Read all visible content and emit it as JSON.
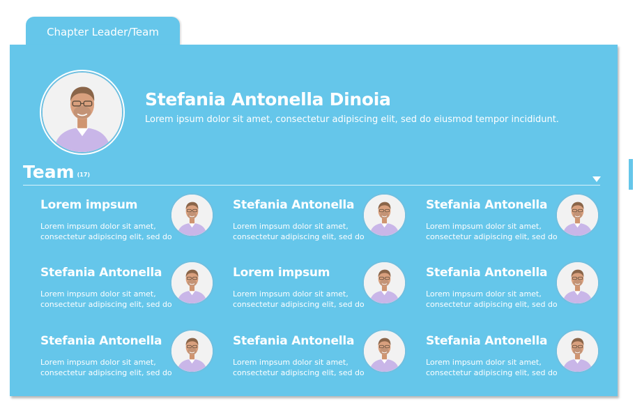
{
  "tab": {
    "label": "Chapter Leader/Team"
  },
  "leader": {
    "name": "Stefania Antonella Dinoia",
    "description": "Lorem ipsum dolor sit amet, consectetur adipiscing elit, sed do eiusmod tempor incididunt."
  },
  "team": {
    "title": "Team",
    "count": "(17)",
    "members": [
      {
        "name": "Lorem impsum",
        "line1": "Lorem impsum dolor sit amet,",
        "line2": "consectetur adipiscing elit, sed do"
      },
      {
        "name": "Stefania Antonella",
        "line1": "Lorem impsum dolor sit amet,",
        "line2": "consectetur adipiscing elit, sed do"
      },
      {
        "name": "Stefania Antonella",
        "line1": "Lorem impsum dolor sit amet,",
        "line2": "consectetur adipiscing elit, sed do"
      },
      {
        "name": "Stefania Antonella",
        "line1": "Lorem impsum dolor sit amet,",
        "line2": "consectetur adipiscing elit, sed do"
      },
      {
        "name": "Lorem impsum",
        "line1": "Lorem impsum dolor sit amet,",
        "line2": "consectetur adipiscing elit, sed do"
      },
      {
        "name": "Stefania Antonella",
        "line1": "Lorem impsum dolor sit amet,",
        "line2": "consectetur adipiscing elit, sed do"
      },
      {
        "name": "Stefania Antonella",
        "line1": "Lorem impsum dolor sit amet,",
        "line2": "consectetur adipiscing elit, sed do"
      },
      {
        "name": "Stefania Antonella",
        "line1": "Lorem impsum dolor sit amet,",
        "line2": "consectetur adipiscing elit, sed do"
      },
      {
        "name": "Stefania Antonella",
        "line1": "Lorem impsum dolor sit amet,",
        "line2": "consectetur adipiscing elit, sed do"
      }
    ]
  },
  "icons": {
    "expand": "chevron-down-icon",
    "avatar": "person-photo"
  },
  "colors": {
    "panel": "#65c6ea",
    "text": "#ffffff",
    "shirt": "#c9b6e8",
    "skin": "#d9a07e"
  }
}
